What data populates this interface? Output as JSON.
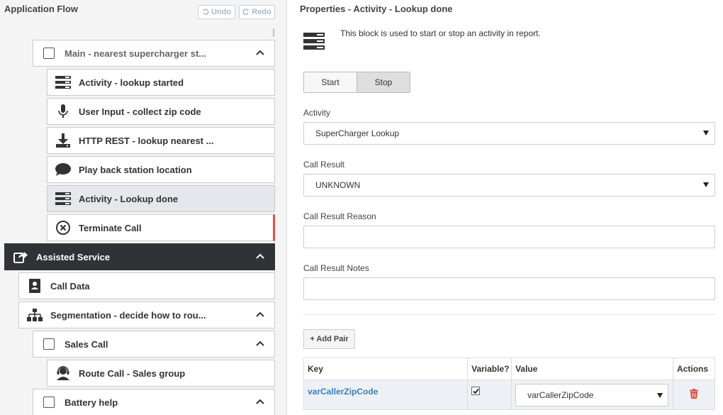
{
  "left_panel": {
    "title": "Application Flow",
    "undo_label": "Undo",
    "redo_label": "Redo",
    "nodes": [
      {
        "label": "Main - nearest supercharger st...",
        "icon": "checkbox",
        "expandable": true
      },
      {
        "label": "Activity - lookup started",
        "icon": "activity-icon"
      },
      {
        "label": "User Input - collect zip code",
        "icon": "microphone-icon"
      },
      {
        "label": "HTTP REST - lookup nearest ...",
        "icon": "download-icon"
      },
      {
        "label": "Play back station location",
        "icon": "speech-bubble-icon"
      },
      {
        "label": "Activity - Lookup done",
        "icon": "activity-icon",
        "selected": true
      },
      {
        "label": "Terminate Call",
        "icon": "terminate-call-icon",
        "error": true
      },
      {
        "label": "Assisted Service",
        "icon": "share-icon",
        "expandable": true,
        "dark": true
      },
      {
        "label": "Call Data",
        "icon": "contact-card-icon"
      },
      {
        "label": "Segmentation - decide how to rou...",
        "icon": "hierarchy-icon",
        "expandable": true
      },
      {
        "label": "Sales Call",
        "icon": "checkbox",
        "expandable": true
      },
      {
        "label": "Route Call - Sales group",
        "icon": "agent-headset-icon"
      },
      {
        "label": "Battery help",
        "icon": "checkbox",
        "expandable": true
      }
    ]
  },
  "properties": {
    "title": "Properties - Activity - Lookup done",
    "description": "This block is used to start or stop an activity in report.",
    "toggle": {
      "start_label": "Start",
      "stop_label": "Stop",
      "selected": "Stop"
    },
    "activity": {
      "label": "Activity",
      "value": "SuperCharger Lookup"
    },
    "call_result": {
      "label": "Call Result",
      "value": "UNKNOWN"
    },
    "call_result_reason": {
      "label": "Call Result Reason",
      "value": ""
    },
    "call_result_notes": {
      "label": "Call Result Notes",
      "value": ""
    },
    "add_pair_label": "+ Add Pair",
    "table": {
      "headers": {
        "key": "Key",
        "variable": "Variable?",
        "value": "Value",
        "actions": "Actions"
      },
      "rows": [
        {
          "key": "varCallerZipCode",
          "variable": true,
          "value": "varCallerZipCode"
        }
      ]
    }
  },
  "colors": {
    "dark_node": "#2f3337",
    "selected_node": "#e4e7eb",
    "error_bar": "#e05141",
    "link_blue": "#3d7eb8",
    "delete_red": "#e05141"
  }
}
